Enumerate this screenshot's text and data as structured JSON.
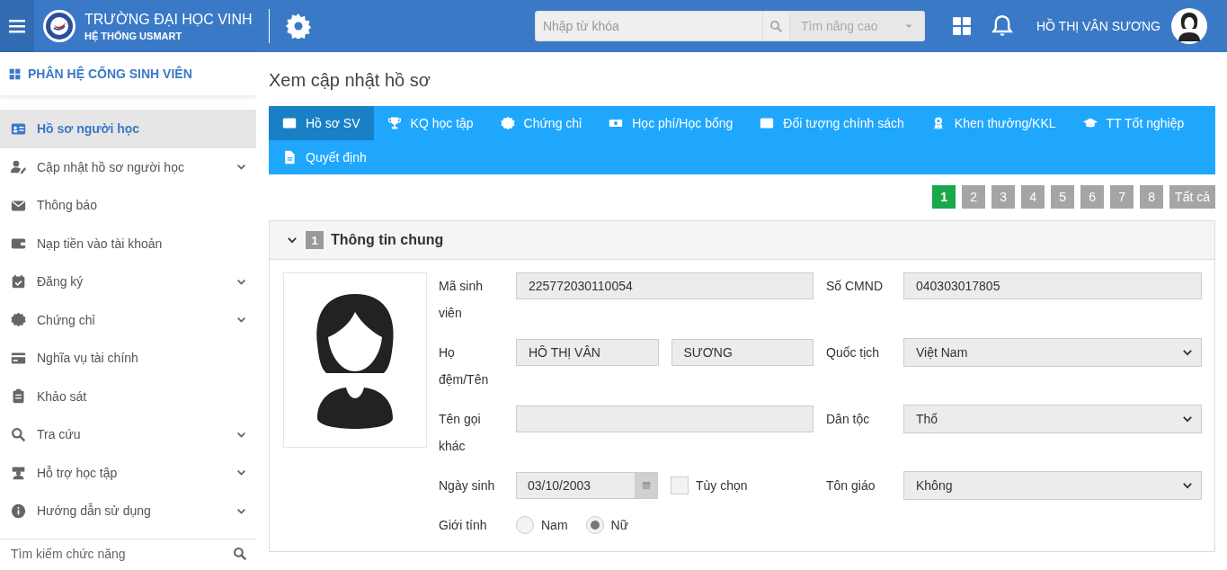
{
  "header": {
    "school_name": "TRƯỜNG ĐẠI HỌC VINH",
    "system_name": "HỆ THỐNG USMART",
    "search": {
      "placeholder": "Nhập từ khóa"
    },
    "advanced_search": "Tìm nâng cao",
    "user_name": "HỒ THỊ VÂN SƯƠNG"
  },
  "sidebar": {
    "title": "PHÂN HỆ CỔNG SINH VIÊN",
    "items": [
      {
        "label": "Hồ sơ người học",
        "selected": true,
        "expandable": false
      },
      {
        "label": "Cập nhật hồ sơ người học",
        "selected": false,
        "expandable": true
      },
      {
        "label": "Thông báo",
        "selected": false,
        "expandable": false
      },
      {
        "label": "Nạp tiền vào tài khoản",
        "selected": false,
        "expandable": false
      },
      {
        "label": "Đăng ký",
        "selected": false,
        "expandable": true
      },
      {
        "label": "Chứng chỉ",
        "selected": false,
        "expandable": true
      },
      {
        "label": "Nghĩa vụ tài chính",
        "selected": false,
        "expandable": false
      },
      {
        "label": "Khảo sát",
        "selected": false,
        "expandable": false
      },
      {
        "label": "Tra cứu",
        "selected": false,
        "expandable": true
      },
      {
        "label": "Hỗ trợ học tập",
        "selected": false,
        "expandable": true
      },
      {
        "label": "Hướng dẫn sử dụng",
        "selected": false,
        "expandable": true
      }
    ],
    "search": {
      "placeholder": "Tìm kiếm chức năng"
    }
  },
  "page_title": "Xem cập nhật hồ sơ",
  "tabs": [
    {
      "label": "Hồ sơ SV",
      "selected": true
    },
    {
      "label": "KQ học tập",
      "selected": false
    },
    {
      "label": "Chứng chỉ",
      "selected": false
    },
    {
      "label": "Học phí/Học bổng",
      "selected": false
    },
    {
      "label": "Đối tượng chính sách",
      "selected": false
    },
    {
      "label": "Khen thưởng/KKL",
      "selected": false
    },
    {
      "label": "TT Tốt nghiệp",
      "selected": false
    },
    {
      "label": "Quyết định",
      "selected": false
    }
  ],
  "pagination": [
    {
      "label": "1",
      "selected": true
    },
    {
      "label": "2",
      "selected": false
    },
    {
      "label": "3",
      "selected": false
    },
    {
      "label": "4",
      "selected": false
    },
    {
      "label": "5",
      "selected": false
    },
    {
      "label": "6",
      "selected": false
    },
    {
      "label": "7",
      "selected": false
    },
    {
      "label": "8",
      "selected": false
    },
    {
      "label": "Tất cả",
      "selected": false
    }
  ],
  "section": {
    "number": "1",
    "title": "Thông tin chung",
    "expanded": true,
    "rows": [
      {
        "label": "Mã sinh viên",
        "fields": [
          {
            "kind": "text",
            "value": "225772030110054"
          }
        ],
        "right_label": "Số CMND",
        "right_field": {
          "kind": "text",
          "value": "040303017805"
        }
      },
      {
        "label": "Họ đệm/Tên",
        "fields": [
          {
            "kind": "text",
            "value": "HỒ THỊ VÂN"
          },
          {
            "kind": "text",
            "value": "SƯƠNG"
          }
        ],
        "right_label": "Quốc tịch",
        "right_field": {
          "kind": "select",
          "value": "Việt Nam"
        }
      },
      {
        "label": "Tên gọi khác",
        "fields": [
          {
            "kind": "text"
          }
        ],
        "right_label": "Dân tộc",
        "right_field": {
          "kind": "select",
          "value": "Thổ"
        }
      },
      {
        "label": "Ngày sinh",
        "fields": [
          {
            "kind": "date",
            "value": "03/10/2003"
          },
          {
            "kind": "checkbox",
            "label": "Tùy chọn",
            "checked": false
          }
        ],
        "right_label": "Tôn giáo",
        "right_field": {
          "kind": "select",
          "value": "Không"
        }
      },
      {
        "label": "Giới tính",
        "fields": [
          {
            "kind": "radio",
            "label": "Nam",
            "selected": false
          },
          {
            "kind": "radio",
            "label": "Nữ",
            "selected": true
          }
        ]
      }
    ]
  }
}
